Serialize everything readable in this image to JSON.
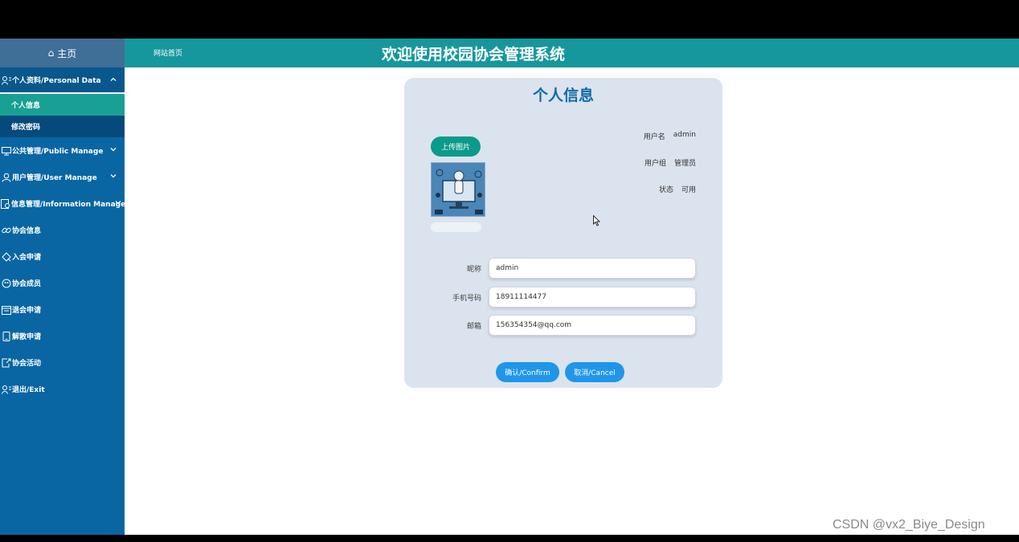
{
  "sidebar": {
    "home_label": "主页",
    "menu": [
      {
        "label": "个人资料/Personal Data",
        "icon": "user-card-icon",
        "open": true
      },
      {
        "label": "公共管理/Public Manage",
        "icon": "monitor-icon"
      },
      {
        "label": "用户管理/User Manage",
        "icon": "user-icon"
      },
      {
        "label": "信息管理/Information Manage",
        "icon": "document-gear-icon"
      },
      {
        "label": "协会信息",
        "icon": "link-icon"
      },
      {
        "label": "入会申请",
        "icon": "join-icon"
      },
      {
        "label": "协会成员",
        "icon": "members-icon"
      },
      {
        "label": "退会申请",
        "icon": "calendar-icon"
      },
      {
        "label": "解散申请",
        "icon": "tablet-icon"
      },
      {
        "label": "协会活动",
        "icon": "export-icon"
      },
      {
        "label": "退出/Exit",
        "icon": "logout-icon"
      }
    ],
    "submenu": [
      {
        "label": "个人信息",
        "active": true
      },
      {
        "label": "修改密码",
        "active": false
      }
    ]
  },
  "header": {
    "home_link": "网站首页",
    "title": "欢迎使用校园协会管理系统"
  },
  "profile": {
    "title": "个人信息",
    "upload_label": "上传图片",
    "info": {
      "username_label": "用户名",
      "username": "admin",
      "group_label": "用户组",
      "group": "管理员",
      "status_label": "状态",
      "status": "可用"
    },
    "form": {
      "nickname_label": "昵称",
      "nickname": "admin",
      "phone_label": "手机号码",
      "phone": "18911114477",
      "email_label": "邮箱",
      "email": "156354354@qq.com"
    },
    "confirm_label": "确认/Confirm",
    "cancel_label": "取消/Cancel"
  },
  "watermark": "CSDN @vx2_Biye_Design",
  "colors": {
    "sidebar": "#0966a3",
    "header": "#16979d",
    "active_sub": "#18a095",
    "card": "#dbe3ee",
    "button": "#1f96ea"
  }
}
